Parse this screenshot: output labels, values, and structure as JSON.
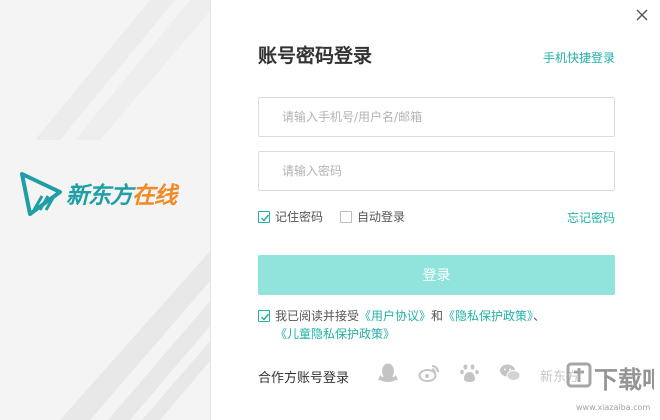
{
  "brand": {
    "name_part1": "新东方",
    "name_part2": "在线",
    "logo": "xdf-logo"
  },
  "window": {
    "close_icon": "close-icon"
  },
  "login": {
    "title": "账号密码登录",
    "switch_link": "手机快捷登录",
    "phone_placeholder": "请输入手机号/用户名/邮箱",
    "password_placeholder": "请输入密码",
    "remember_label": "记住密码",
    "remember_checked": true,
    "auto_login_label": "自动登录",
    "auto_login_checked": false,
    "forgot_link": "忘记密码",
    "submit_label": "登录"
  },
  "agreement": {
    "checked": true,
    "prefix": "我已阅读并接受",
    "link_user": "《用户协议》",
    "conj": "和",
    "link_privacy": "《隐私保护政策》",
    "sep": "、",
    "link_child": "《儿童隐私保护政策》"
  },
  "partner": {
    "label": "合作方账号登录",
    "icons": [
      "qq-icon",
      "weibo-icon",
      "baidu-paw-icon",
      "wechat-icon"
    ],
    "more": "新东方"
  },
  "watermark": {
    "text": "下载吧",
    "icon": "watermark-logo"
  },
  "colors": {
    "accent": "#21b1a6",
    "button": "#91e4dc",
    "brand_teal": "#1f9fa5",
    "brand_orange": "#f08a24"
  }
}
